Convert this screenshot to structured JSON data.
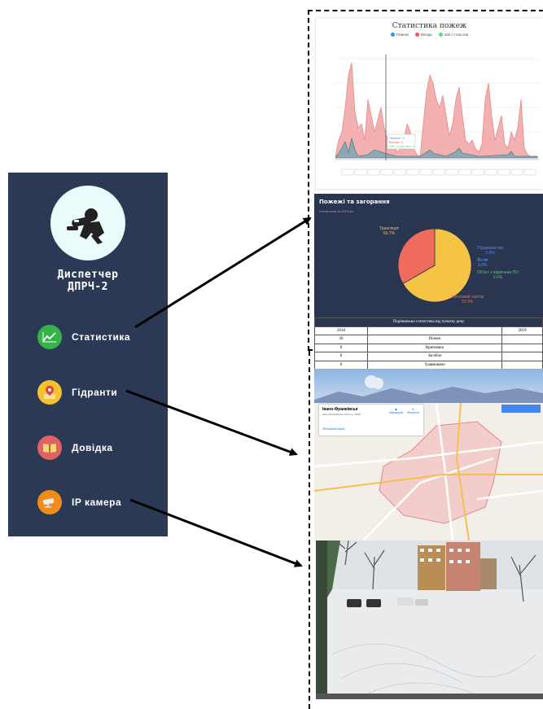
{
  "sidebar": {
    "title_line1": "Диспетчер",
    "title_line2": "ДПРЧ-2",
    "items": [
      {
        "label": "Статистика",
        "icon": "chart-icon",
        "color": "#36b24a"
      },
      {
        "label": "Гідранти",
        "icon": "map-pin-icon",
        "color": "#f2c230"
      },
      {
        "label": "Довідка",
        "icon": "book-icon",
        "color": "#e06262"
      },
      {
        "label": "IP камера",
        "icon": "camera-icon",
        "color": "#f08c1a"
      }
    ],
    "background": "#2c3954"
  },
  "stats_panel": {
    "title": "Статистика пожеж",
    "legend": [
      "Пожежі",
      "Виїзди",
      "Заб.і стаж.хви"
    ],
    "series_colors": [
      "#3b8fd6",
      "#ef5a5a",
      "#67d18a"
    ],
    "tooltip": [
      "Пожежі: 0",
      "Виїзди: 0",
      "Заб.і стаж.хви: 0"
    ]
  },
  "pie_panel": {
    "title": "Пожежі та загорання",
    "subtitle": "статистика за 2019 рік",
    "slices": [
      {
        "label": "Транспорт",
        "value": "66.7%",
        "color": "#f6c445"
      },
      {
        "label": "Житловий сектор",
        "value": "33.3%",
        "color": "#ef6b5d"
      },
      {
        "label": "Підприємства",
        "value": "0.0%",
        "color": "#6f7df2"
      },
      {
        "label": "Лісові",
        "value": "0.0%",
        "color": "#4fa3f2"
      },
      {
        "label": "Об'єкт з відмічени ПО",
        "value": "0.0%",
        "color": "#5ec26f"
      }
    ]
  },
  "comparison_table": {
    "header": "Порівняльна статистика від початку року",
    "year_left": "2018",
    "year_right": "2019",
    "rows": [
      {
        "left": "20",
        "label": "Пожеж",
        "right": ""
      },
      {
        "left": "0",
        "label": "Врятовано",
        "right": ""
      },
      {
        "left": "0",
        "label": "Загибло",
        "right": ""
      },
      {
        "left": "0",
        "label": "Травмовано",
        "right": ""
      }
    ]
  },
  "map_panel": {
    "place_name": "Івано-Франківськ",
    "place_sub": "Івано-Франківська область, 76000",
    "directions": "Маршрути",
    "save": "Зберегти",
    "larger_map": "Збільшена карта"
  },
  "camera_panel": {}
}
